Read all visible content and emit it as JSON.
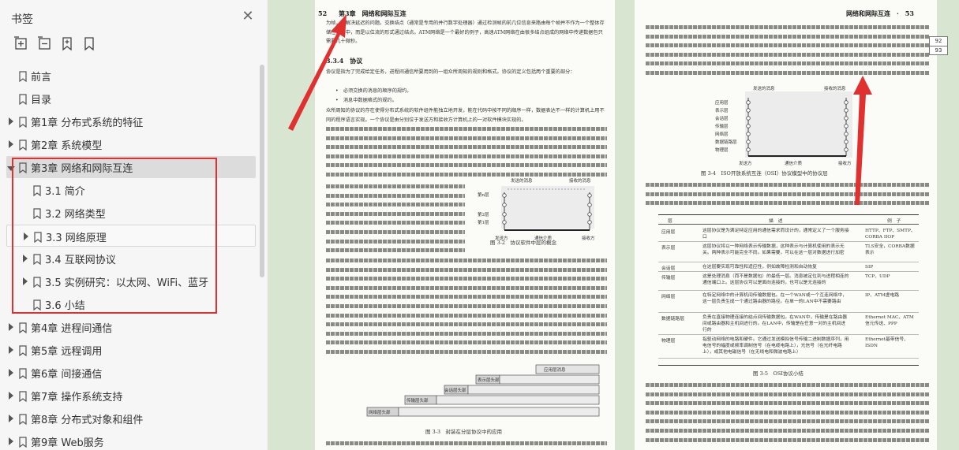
{
  "sidebar": {
    "title": "书签",
    "close_icon": "close-icon",
    "tools": [
      "expand-all-icon",
      "collapse-all-icon",
      "add-bookmark-icon",
      "bookmark-icon"
    ],
    "items": [
      {
        "label": "前言",
        "level": 0,
        "expandable": false
      },
      {
        "label": "目录",
        "level": 0,
        "expandable": false
      },
      {
        "label": "第1章 分布式系统的特征",
        "level": 0,
        "expandable": true
      },
      {
        "label": "第2章 系统模型",
        "level": 0,
        "expandable": true
      },
      {
        "label": "第3章 网络和网际互连",
        "level": 0,
        "expandable": true,
        "expanded": true,
        "selected": true
      },
      {
        "label": "3.1 简介",
        "level": 1,
        "expandable": false
      },
      {
        "label": "3.2 网络类型",
        "level": 1,
        "expandable": false
      },
      {
        "label": "3.3 网络原理",
        "level": 1,
        "expandable": true
      },
      {
        "label": "3.4 互联网协议",
        "level": 1,
        "expandable": true
      },
      {
        "label": "3.5 实例研究：以太网、WiFi、蓝牙",
        "level": 1,
        "expandable": true
      },
      {
        "label": "3.6 小结",
        "level": 1,
        "expandable": false
      },
      {
        "label": "第4章 进程间通信",
        "level": 0,
        "expandable": true
      },
      {
        "label": "第5章 远程调用",
        "level": 0,
        "expandable": true
      },
      {
        "label": "第6章 间接通信",
        "level": 0,
        "expandable": true
      },
      {
        "label": "第7章 操作系统支持",
        "level": 0,
        "expandable": true
      },
      {
        "label": "第8章 分布式对象和组件",
        "level": 0,
        "expandable": true
      },
      {
        "label": "第9章 Web服务",
        "level": 0,
        "expandable": true
      }
    ]
  },
  "left_page": {
    "page_number": "52",
    "header": "第3章　网络和网际互连",
    "section": "3.3.4　协议",
    "figure_caption": "图 3-3　封装在分层协议中的应用",
    "figure2_caption": "图 3-2　协议软件中层的概念",
    "fig2_labels": {
      "sent": "发送的消息",
      "received": "接收的消息",
      "layer_n": "第n层",
      "layer_2": "第2层",
      "layer_1": "第1层",
      "sender": "发送方",
      "medium": "通信介质",
      "receiver": "接收方"
    },
    "fig3_labels": [
      "应用层消息",
      "表示层头部",
      "会话层头部",
      "传输层头部",
      "网络层头部"
    ],
    "body_top": "为帧，来解决延迟的问题。交换结点（通常是专用的并行数字处理器）通过检测帧的前几位信息来路由每个帧并不作为一个整体存储在结点中，而是以位流的形式通过结点。ATM网络是一个最好的例子，高速ATM网络在由很多结点组成的网络中传递数据包只需要几十微秒。",
    "body_intro": "协议是指为了完成给定任务，进程间通信所要用到的一组众所周知的规则和格式。协议的定义包括两个重要的部分：",
    "bullets": [
      "必须交换的消息的顺序的规约。",
      "消息中数据格式的规约。"
    ],
    "body_mid": "众所周知的协议的存在使得分布式系统的软件组件能独立地开发，能在代码中按不同的顺序一样，数据表达不一样的计算机上用不同的程序语言实现。一个协议是由分别位于发送方和接收方计算机上的一对软件模块实现的。"
  },
  "right_page": {
    "page_number": "53",
    "header": "网络和网际互连　·　53",
    "figure_caption": "图 3-4　ISO开放系统互连（OSI）协议模型中的协议层",
    "fig4_labels": {
      "sent": "发送的消息",
      "received": "接收的消息",
      "layers": [
        "应用层",
        "表示层",
        "会话层",
        "传输层",
        "网络层",
        "数据链路层",
        "物理层"
      ],
      "sender": "发送方",
      "medium": "通信介质",
      "receiver": "接收方"
    },
    "table_caption": "图 3-5　OSI协议小结",
    "table_headers": [
      "层",
      "描　述",
      "例　子"
    ],
    "table_rows": [
      {
        "layer": "应用层",
        "desc": "这层协议是为满足特定应用的通信需求而设计的，通常定义了一个服务接口",
        "example": "HTTP、FTP、SMTP、CORBA IIOP"
      },
      {
        "layer": "表示层",
        "desc": "这层协议将以一种网络表示传输数据，这种表示与计算机使用的表示无关。两种表示可能完全不同。如果需要，可以在这一层对数据进行加密",
        "example": "TLS安全，CORBA数据表示"
      },
      {
        "layer": "会话层",
        "desc": "在这层要实现可靠性和适应性，例如故障检测和自动恢复",
        "example": "SIP"
      },
      {
        "layer": "传输层",
        "desc": "这是处理消息（而不是数据包）的最低一层。消息被定位到与进程相连的通信端口上。这层协议可以是面向连接的，也可以是无连接的",
        "example": "TCP、UDP"
      },
      {
        "layer": "网络层",
        "desc": "在特定网络中的计算机间传输数据包。在一个WAN或一个互连网络中，这一层负责生成一个通过路由器的路径。在单一的LAN中不需要路由",
        "example": "IP、ATM虚电路"
      },
      {
        "layer": "数据链路层",
        "desc": "负责在直接物理连接的结点间传输数据包。在WAN中，传输是在路由器间或路由器和主机间进行的。在LAN中，传输是在任意一对的主机间进行的",
        "example": "Ethernet MAC、ATM信元传送、PPP"
      },
      {
        "layer": "物理层",
        "desc": "指驱动网络的电路和硬件。它通过发送模拟信号传输二进制数据序列，用电信号的幅度或频率调制信号（在电缆电路上），光信号（在光纤电路上），或其他电磁信号（在无线电和微波电路上）",
        "example": "Ethernet基带信号、ISDN"
      }
    ],
    "page_indicator": {
      "current": "92",
      "total": "93"
    }
  },
  "colors": {
    "annotation_red": "#e03131",
    "viewer_bg": "#d7e5d1",
    "selected_item": "#dcdcdc"
  }
}
